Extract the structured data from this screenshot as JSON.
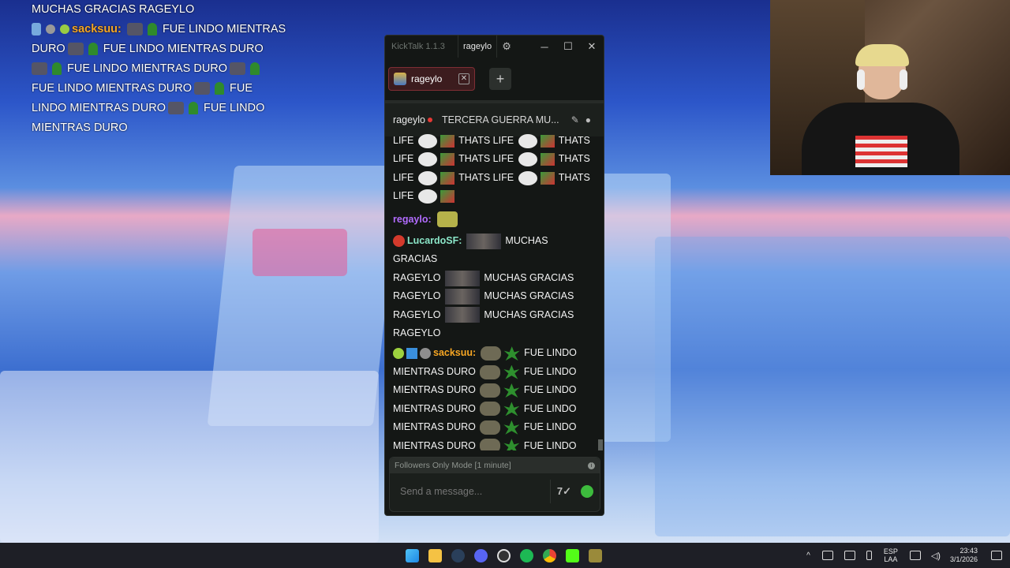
{
  "overlay": {
    "line1": "MUCHAS GRACIAS RAGEYLO",
    "nick": "sacksuu:",
    "msg_a": "FUE LINDO MIENTRAS",
    "msg_b": "DURO",
    "msg_c": "FUE LINDO MIENTRAS DURO",
    "msg_d": "FUE LINDO MIENTRAS DURO",
    "msg_e": "FUE LINDO MIENTRAS DURO",
    "msg_f": "FUE",
    "msg_g": "LINDO MIENTRAS DURO",
    "msg_h": "FUE LINDO",
    "msg_i": "MIENTRAS DURO"
  },
  "app": {
    "name": "KickTalk 1.1.3",
    "channel_button": "rageylo",
    "tab_label": "rageylo",
    "add_tab": "+",
    "minimize": "─",
    "maximize": "☐",
    "close": "✕"
  },
  "stream": {
    "streamer": "rageylo",
    "title": "TERCERA GUERRA MU..."
  },
  "chat": {
    "thats": "THATS",
    "life": "LIFE",
    "thats_life": "THATS LIFE",
    "regaylo_nick": "regaylo:",
    "lucardo_nick": "LucardoSF:",
    "muchas": "MUCHAS GRACIAS",
    "rageylo_word": "RAGEYLO",
    "sack_nick": "sacksuu:",
    "fue_lindo": "FUE LINDO",
    "mientras_duro": "MIENTRAS DURO"
  },
  "input": {
    "mode": "Followers Only Mode [1 minute]",
    "placeholder": "Send a message..."
  },
  "taskbar": {
    "lang_top": "ESP",
    "lang_bottom": "LAA",
    "time": "23:43",
    "date": "3/1/2026"
  }
}
